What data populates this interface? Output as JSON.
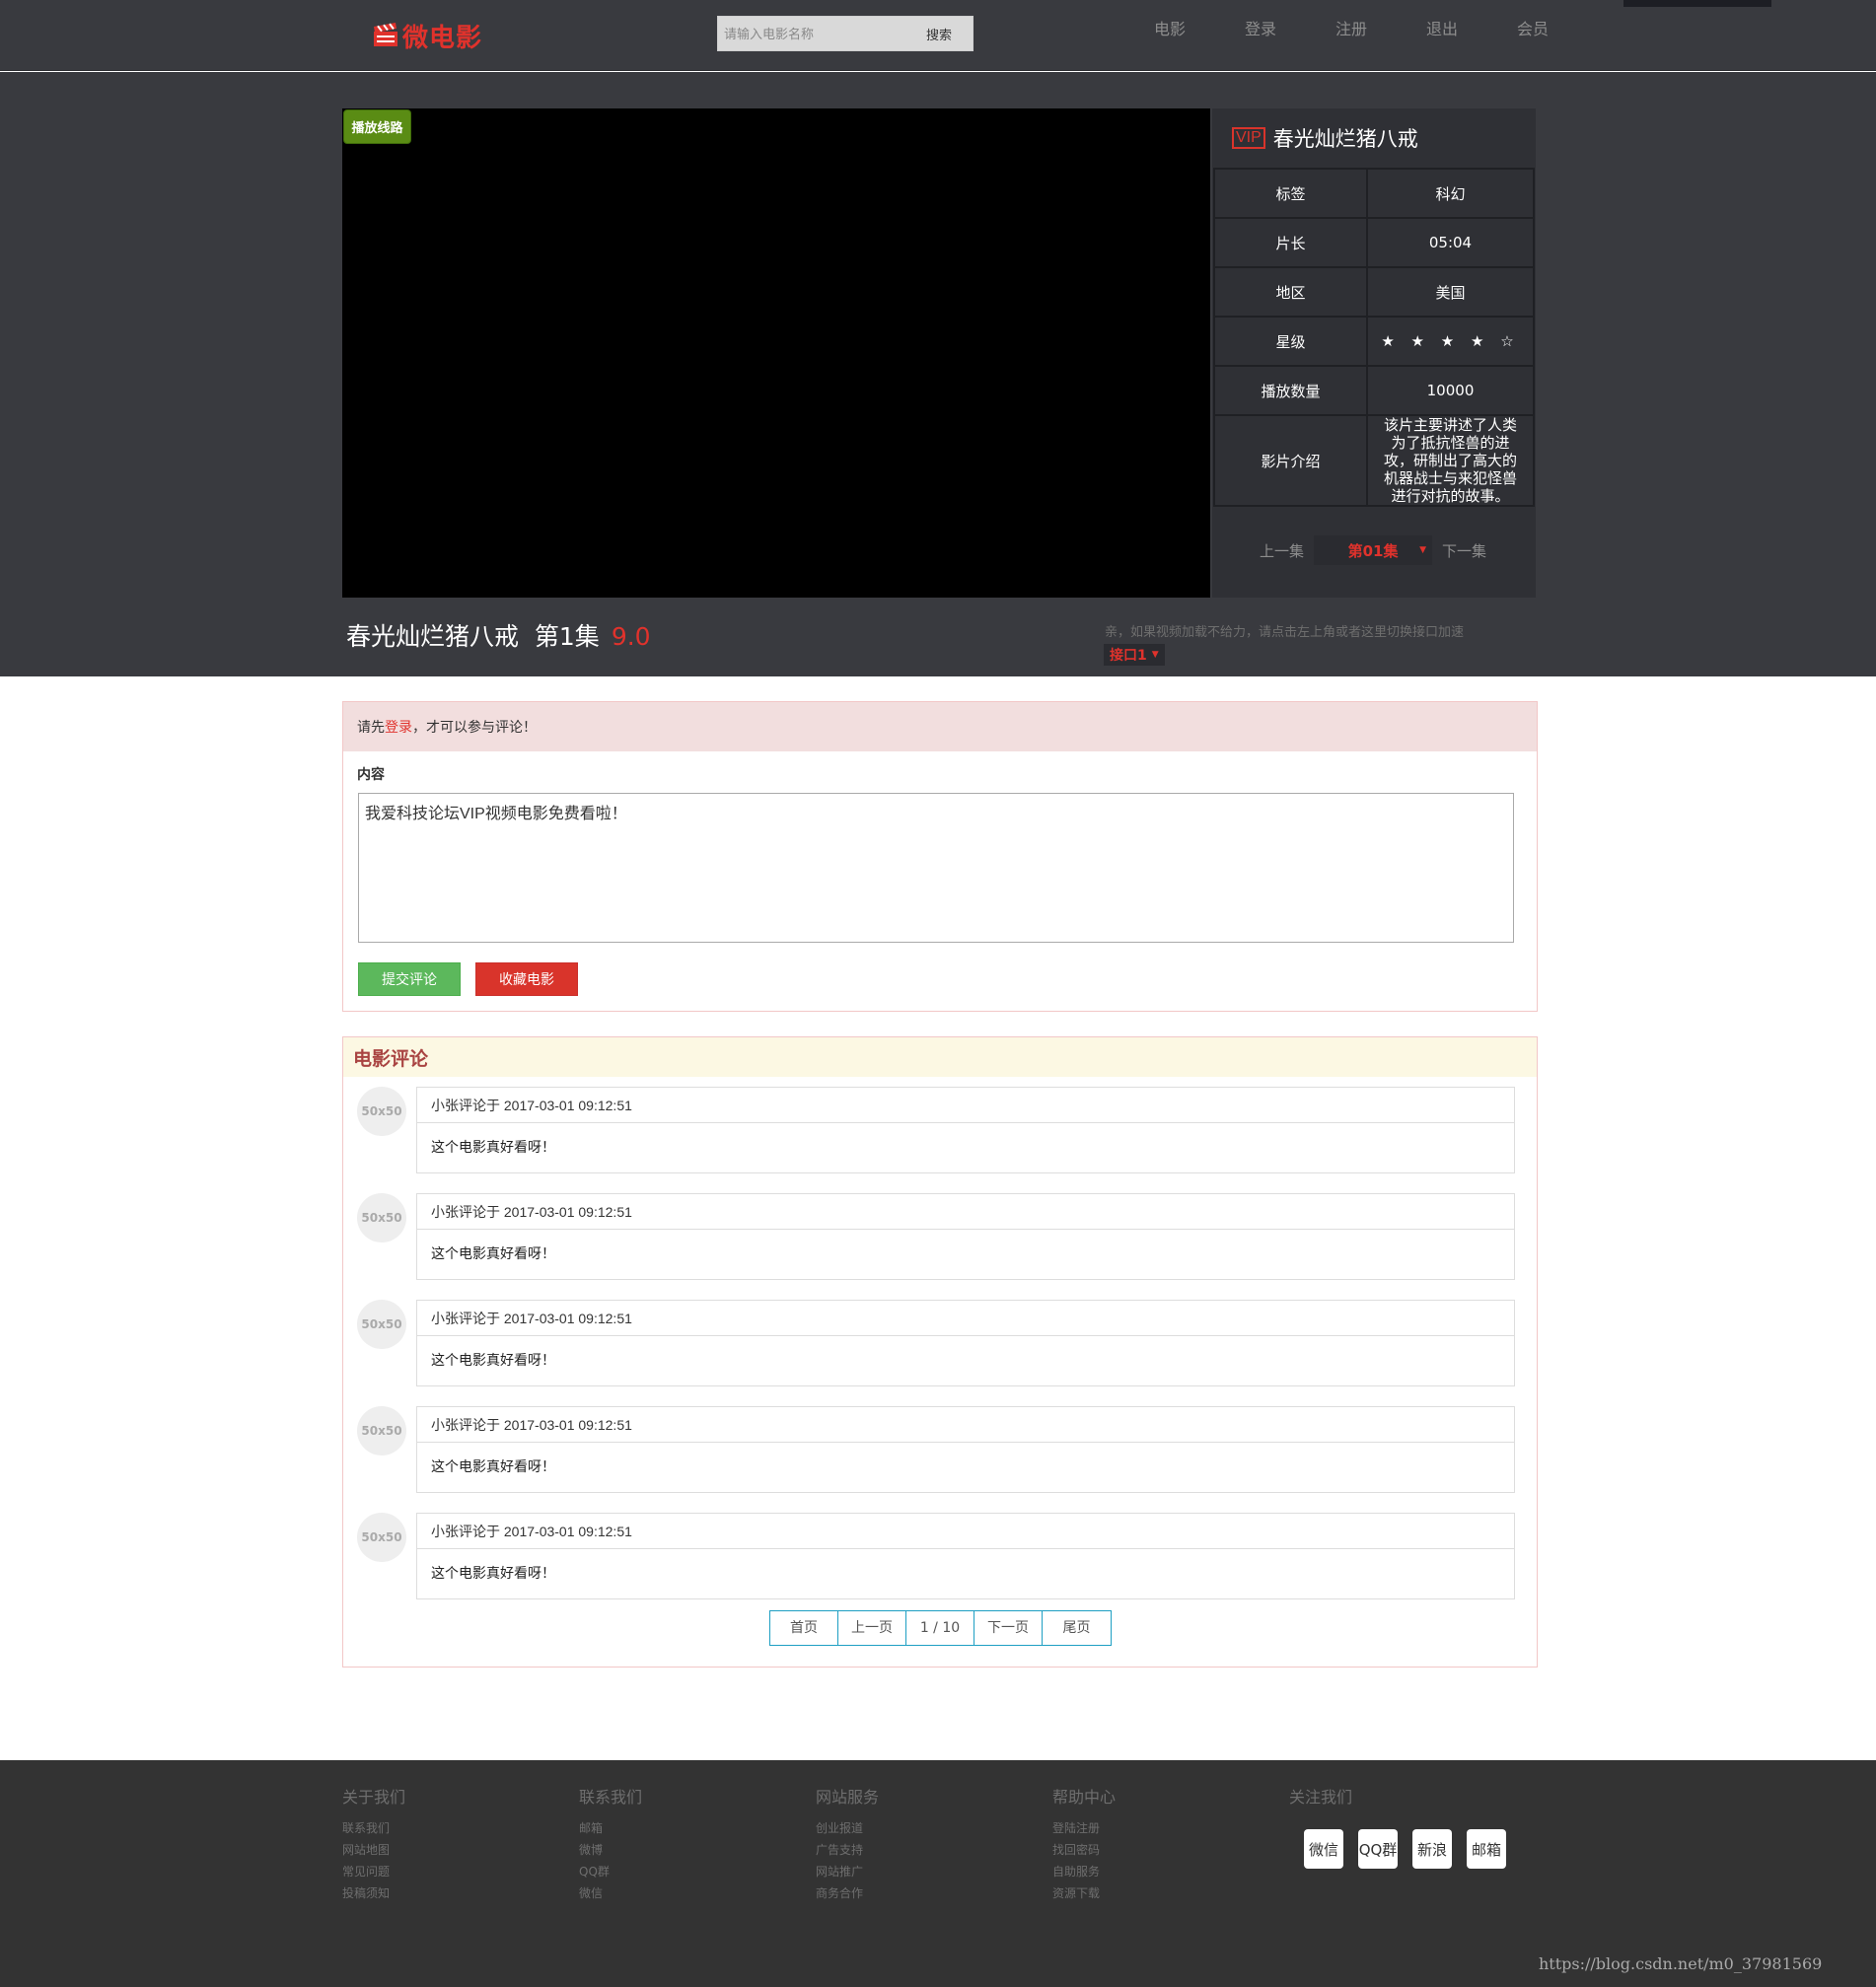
{
  "header": {
    "logo_text": "微电影",
    "search_placeholder": "请输入电影名称",
    "search_button": "搜索",
    "nav": [
      "电影",
      "登录",
      "注册",
      "退出",
      "会员"
    ]
  },
  "player": {
    "route_badge": "播放线路",
    "vip_label": "VIP",
    "side_title": "春光灿烂猪八戒",
    "info_rows": [
      {
        "key": "标签",
        "value": "科幻"
      },
      {
        "key": "片长",
        "value": "05:04"
      },
      {
        "key": "地区",
        "value": "美国"
      },
      {
        "key": "星级",
        "value": "★ ★ ★ ★ ☆"
      },
      {
        "key": "播放数量",
        "value": "10000"
      },
      {
        "key": "影片介绍",
        "value": "该片主要讲述了人类为了抵抗怪兽的进攻，研制出了高大的机器战士与来犯怪兽进行对抗的故事。"
      }
    ],
    "prev_episode": "上一集",
    "current_episode": "第01集",
    "next_episode": "下一集",
    "main_title": "春光灿烂猪八戒  第1集",
    "score": "9.0",
    "hint": "亲，如果视频加载不给力，请点击左上角或者这里切换接口加速",
    "interface": "接口1"
  },
  "comment_form": {
    "alert_prefix": "请先",
    "alert_link": "登录",
    "alert_suffix": "，才可以参与评论！",
    "content_label": "内容",
    "content_value": "我爱科技论坛VIP视频电影免费看啦！",
    "submit_button": "提交评论",
    "favorite_button": "收藏电影"
  },
  "comments": {
    "heading": "电影评论",
    "items": [
      {
        "avatar": "50x50",
        "meta": "小张评论于 2017-03-01 09:12:51",
        "text": "这个电影真好看呀！"
      },
      {
        "avatar": "50x50",
        "meta": "小张评论于 2017-03-01 09:12:51",
        "text": "这个电影真好看呀！"
      },
      {
        "avatar": "50x50",
        "meta": "小张评论于 2017-03-01 09:12:51",
        "text": "这个电影真好看呀！"
      },
      {
        "avatar": "50x50",
        "meta": "小张评论于 2017-03-01 09:12:51",
        "text": "这个电影真好看呀！"
      },
      {
        "avatar": "50x50",
        "meta": "小张评论于 2017-03-01 09:12:51",
        "text": "这个电影真好看呀！"
      }
    ],
    "pager": [
      "首页",
      "上一页",
      "1 / 10",
      "下一页",
      "尾页"
    ]
  },
  "footer": {
    "columns": [
      {
        "title": "关于我们",
        "links": [
          "联系我们",
          "网站地图",
          "常见问题",
          "投稿须知"
        ]
      },
      {
        "title": "联系我们",
        "links": [
          "邮箱",
          "微博",
          "QQ群",
          "微信"
        ]
      },
      {
        "title": "网站服务",
        "links": [
          "创业报道",
          "广告支持",
          "网站推广",
          "商务合作"
        ]
      },
      {
        "title": "帮助中心",
        "links": [
          "登陆注册",
          "找回密码",
          "自助服务",
          "资源下载"
        ]
      },
      {
        "title": "关注我们",
        "links": []
      }
    ],
    "social": [
      "微信",
      "QQ群",
      "新浪",
      "邮箱"
    ]
  },
  "watermark": "https://blog.csdn.net/m0_37981569",
  "colors": {
    "accent": "#e0322c",
    "dark_bg": "#393a3f",
    "footer_bg": "#333333",
    "success": "#5cb85c"
  }
}
